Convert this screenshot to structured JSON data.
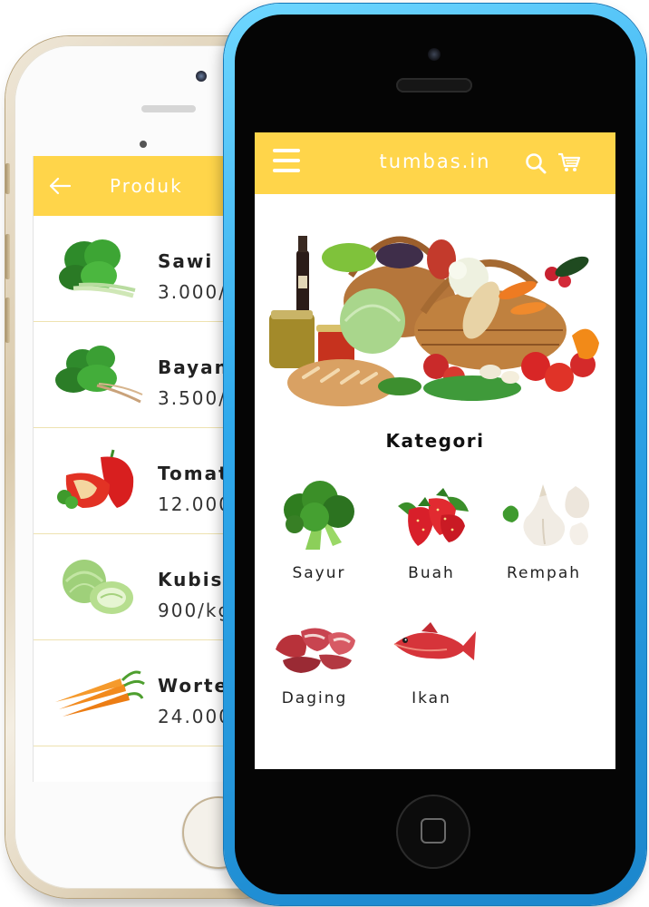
{
  "back_screen": {
    "header": {
      "back_icon": "arrow-left-icon",
      "title": "Produk"
    },
    "products": [
      {
        "name": "Sawi",
        "price": "3.000/",
        "image": "mustard-greens"
      },
      {
        "name": "Bayan",
        "price": "3.500/",
        "image": "spinach"
      },
      {
        "name": "Tomat",
        "price": "12.000",
        "image": "red-pepper"
      },
      {
        "name": "Kubis",
        "price": "900/kg",
        "image": "cabbage"
      },
      {
        "name": "Wortel",
        "price": "24.000",
        "image": "carrots"
      }
    ]
  },
  "front_screen": {
    "header": {
      "menu_icon": "hamburger-menu-icon",
      "title": "tumbas.in",
      "search_icon": "search-icon",
      "cart_icon": "shopping-cart-icon"
    },
    "hero_image": "grocery-basket",
    "categories_title": "Kategori",
    "categories": [
      {
        "label": "Sayur",
        "image": "broccoli"
      },
      {
        "label": "Buah",
        "image": "strawberries"
      },
      {
        "label": "Rempah",
        "image": "garlic"
      },
      {
        "label": "Daging",
        "image": "meat"
      },
      {
        "label": "Ikan",
        "image": "fish"
      }
    ]
  },
  "colors": {
    "header_yellow": "#ffd54a",
    "phone_blue": "#2fa9ec",
    "phone_gold": "#d9c9aa"
  }
}
